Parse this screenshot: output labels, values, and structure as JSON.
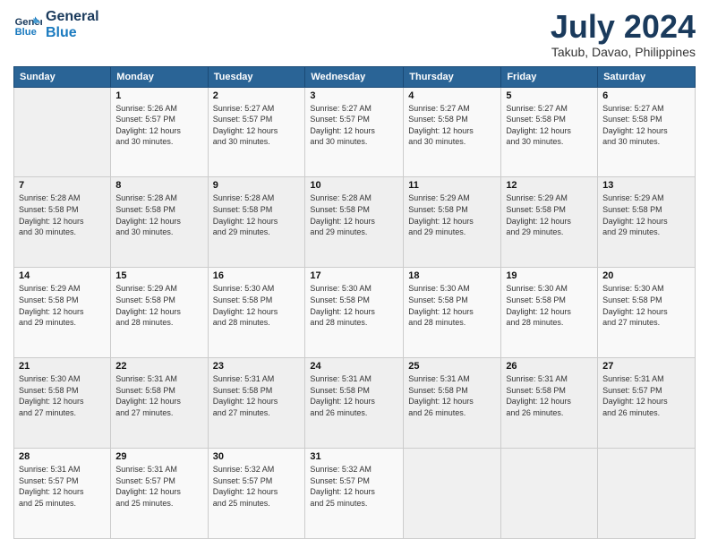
{
  "header": {
    "logo_line1": "General",
    "logo_line2": "Blue",
    "month_year": "July 2024",
    "location": "Takub, Davao, Philippines"
  },
  "weekdays": [
    "Sunday",
    "Monday",
    "Tuesday",
    "Wednesday",
    "Thursday",
    "Friday",
    "Saturday"
  ],
  "weeks": [
    [
      {
        "day": "",
        "info": ""
      },
      {
        "day": "1",
        "info": "Sunrise: 5:26 AM\nSunset: 5:57 PM\nDaylight: 12 hours\nand 30 minutes."
      },
      {
        "day": "2",
        "info": "Sunrise: 5:27 AM\nSunset: 5:57 PM\nDaylight: 12 hours\nand 30 minutes."
      },
      {
        "day": "3",
        "info": "Sunrise: 5:27 AM\nSunset: 5:57 PM\nDaylight: 12 hours\nand 30 minutes."
      },
      {
        "day": "4",
        "info": "Sunrise: 5:27 AM\nSunset: 5:58 PM\nDaylight: 12 hours\nand 30 minutes."
      },
      {
        "day": "5",
        "info": "Sunrise: 5:27 AM\nSunset: 5:58 PM\nDaylight: 12 hours\nand 30 minutes."
      },
      {
        "day": "6",
        "info": "Sunrise: 5:27 AM\nSunset: 5:58 PM\nDaylight: 12 hours\nand 30 minutes."
      }
    ],
    [
      {
        "day": "7",
        "info": "Sunrise: 5:28 AM\nSunset: 5:58 PM\nDaylight: 12 hours\nand 30 minutes."
      },
      {
        "day": "8",
        "info": "Sunrise: 5:28 AM\nSunset: 5:58 PM\nDaylight: 12 hours\nand 30 minutes."
      },
      {
        "day": "9",
        "info": "Sunrise: 5:28 AM\nSunset: 5:58 PM\nDaylight: 12 hours\nand 29 minutes."
      },
      {
        "day": "10",
        "info": "Sunrise: 5:28 AM\nSunset: 5:58 PM\nDaylight: 12 hours\nand 29 minutes."
      },
      {
        "day": "11",
        "info": "Sunrise: 5:29 AM\nSunset: 5:58 PM\nDaylight: 12 hours\nand 29 minutes."
      },
      {
        "day": "12",
        "info": "Sunrise: 5:29 AM\nSunset: 5:58 PM\nDaylight: 12 hours\nand 29 minutes."
      },
      {
        "day": "13",
        "info": "Sunrise: 5:29 AM\nSunset: 5:58 PM\nDaylight: 12 hours\nand 29 minutes."
      }
    ],
    [
      {
        "day": "14",
        "info": "Sunrise: 5:29 AM\nSunset: 5:58 PM\nDaylight: 12 hours\nand 29 minutes."
      },
      {
        "day": "15",
        "info": "Sunrise: 5:29 AM\nSunset: 5:58 PM\nDaylight: 12 hours\nand 28 minutes."
      },
      {
        "day": "16",
        "info": "Sunrise: 5:30 AM\nSunset: 5:58 PM\nDaylight: 12 hours\nand 28 minutes."
      },
      {
        "day": "17",
        "info": "Sunrise: 5:30 AM\nSunset: 5:58 PM\nDaylight: 12 hours\nand 28 minutes."
      },
      {
        "day": "18",
        "info": "Sunrise: 5:30 AM\nSunset: 5:58 PM\nDaylight: 12 hours\nand 28 minutes."
      },
      {
        "day": "19",
        "info": "Sunrise: 5:30 AM\nSunset: 5:58 PM\nDaylight: 12 hours\nand 28 minutes."
      },
      {
        "day": "20",
        "info": "Sunrise: 5:30 AM\nSunset: 5:58 PM\nDaylight: 12 hours\nand 27 minutes."
      }
    ],
    [
      {
        "day": "21",
        "info": "Sunrise: 5:30 AM\nSunset: 5:58 PM\nDaylight: 12 hours\nand 27 minutes."
      },
      {
        "day": "22",
        "info": "Sunrise: 5:31 AM\nSunset: 5:58 PM\nDaylight: 12 hours\nand 27 minutes."
      },
      {
        "day": "23",
        "info": "Sunrise: 5:31 AM\nSunset: 5:58 PM\nDaylight: 12 hours\nand 27 minutes."
      },
      {
        "day": "24",
        "info": "Sunrise: 5:31 AM\nSunset: 5:58 PM\nDaylight: 12 hours\nand 26 minutes."
      },
      {
        "day": "25",
        "info": "Sunrise: 5:31 AM\nSunset: 5:58 PM\nDaylight: 12 hours\nand 26 minutes."
      },
      {
        "day": "26",
        "info": "Sunrise: 5:31 AM\nSunset: 5:58 PM\nDaylight: 12 hours\nand 26 minutes."
      },
      {
        "day": "27",
        "info": "Sunrise: 5:31 AM\nSunset: 5:57 PM\nDaylight: 12 hours\nand 26 minutes."
      }
    ],
    [
      {
        "day": "28",
        "info": "Sunrise: 5:31 AM\nSunset: 5:57 PM\nDaylight: 12 hours\nand 25 minutes."
      },
      {
        "day": "29",
        "info": "Sunrise: 5:31 AM\nSunset: 5:57 PM\nDaylight: 12 hours\nand 25 minutes."
      },
      {
        "day": "30",
        "info": "Sunrise: 5:32 AM\nSunset: 5:57 PM\nDaylight: 12 hours\nand 25 minutes."
      },
      {
        "day": "31",
        "info": "Sunrise: 5:32 AM\nSunset: 5:57 PM\nDaylight: 12 hours\nand 25 minutes."
      },
      {
        "day": "",
        "info": ""
      },
      {
        "day": "",
        "info": ""
      },
      {
        "day": "",
        "info": ""
      }
    ]
  ]
}
